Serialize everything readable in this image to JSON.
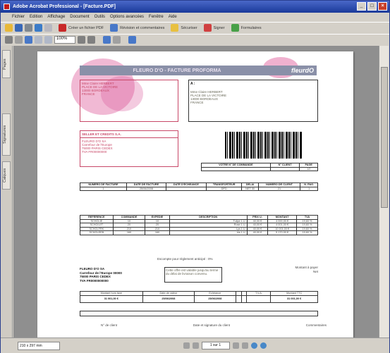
{
  "window": {
    "title": "Adobe Acrobat Professional - [Facture.PDF]"
  },
  "menu": [
    "Fichier",
    "Edition",
    "Affichage",
    "Document",
    "Outils",
    "Options avancées",
    "Fenêtre",
    "Aide"
  ],
  "toolbar": {
    "create_pdf": "Créer un fichier PDF",
    "review": "Révision et commentaires",
    "secure": "Sécuriser",
    "sign": "Signer",
    "forms": "Formulaires",
    "zoom": "100%"
  },
  "sidebar": {
    "tabs": [
      "Pages",
      "Signatures",
      "Calques"
    ]
  },
  "invoice": {
    "banner_title": "FLEURO D'O - FACTURE PROFORMA",
    "logo": "fleurdO",
    "a_label": "A :",
    "recipient_lines": [
      "Mme Claire HERBERT",
      "PLACE DE LA VICTOIRE",
      "13000 BORDEAUX",
      "FRANCE"
    ],
    "a_lines": [
      "Mme Claire HERBERT",
      "PLACE DE LA VICTOIRE",
      "13000 BORDEAUX",
      "FRANCE"
    ],
    "seller_title": "SELLER ET CREDITS S.A.",
    "seller_lines": [
      "FLEURO D'O SA",
      "Carrefour de l'Europe",
      "75000 PARIS CEDEX",
      "TVA FR00000000"
    ],
    "ref_headers": [
      "VOTRE N° DE COMMANDE",
      "N° CLIENT",
      "PAGE"
    ],
    "ref_values": [
      "",
      "",
      "1/2"
    ],
    "info_headers": [
      "NUMERO DE FACTURE",
      "DATE DE FACTURE",
      "DATE D'ECHEANCE",
      "TRANSPORTEUR",
      "DELAI",
      "NUMERO DE CLIENT",
      "N. PAG."
    ],
    "info_values": [
      "1",
      "25/06/2008",
      "",
      "DPD",
      "NET 30",
      "21",
      "1"
    ],
    "line_headers": [
      "REFERENCE",
      "COMMANDE",
      "EXPEDIE",
      "DESCRIPTION",
      "PRIX U.",
      "MONTANT",
      "TVA"
    ],
    "lines": [
      [
        "SCHOLIE",
        "10",
        "10",
        "Tulipe 1 U.",
        "40,00 €",
        "4 000,00 €",
        "19,60 %"
      ],
      [
        "SCHOLVIT",
        "20",
        "20",
        "Rose 1 U.",
        "40,00 €",
        "4 001,00 €",
        "19,60 %"
      ],
      [
        "SCHOLFRK",
        "210",
        "210",
        "Lys 1 U.",
        "40,00 €",
        "10 001,00 €",
        "19,60 %"
      ],
      [
        "SCHOLEEB",
        "160",
        "160",
        "Iris 1 U.",
        "40,00 €",
        "5 170,00 €",
        "19,60 %"
      ]
    ],
    "payment_note": "Escompte pour règlement anticipé : 0%",
    "footer_left": [
      "FLEURO D'O SA",
      "Carrefour de l'Europe 00000",
      "75000 PARIS CEDEX",
      "TVA FR0000000000"
    ],
    "footer_note": "Cette offre est valable jusqu'au terme du délai de livraison convenu.",
    "footer_right": [
      "Montant à payer",
      "Net"
    ],
    "totals_headers": [
      "Montant hors taxe",
      "Date de valeur",
      "Echéance",
      "",
      "",
      "T.V.A.",
      "Montant TTC"
    ],
    "totals_values": [
      "31 001,00 €",
      "25/06/2008",
      "25/06/2008",
      "",
      "",
      "",
      "31 001,00 €"
    ],
    "bottom_labels": [
      "N° de client",
      "Date et signature du client",
      "Commentaires"
    ]
  },
  "status": {
    "page": "1 sur 1",
    "size": "210 x 297 mm"
  }
}
